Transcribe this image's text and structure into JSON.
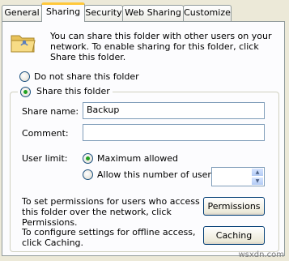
{
  "tabs": [
    {
      "label": "General"
    },
    {
      "label": "Sharing"
    },
    {
      "label": "Security"
    },
    {
      "label": "Web Sharing"
    },
    {
      "label": "Customize"
    }
  ],
  "active_tab": "Sharing",
  "intro_text": "You can share this folder with other users on your network.  To enable sharing for this folder, click Share this folder.",
  "options": {
    "do_not_share": "Do not share this folder",
    "share": "Share this folder"
  },
  "share_name": {
    "label": "Share name:",
    "value": "Backup"
  },
  "comment": {
    "label": "Comment:",
    "value": ""
  },
  "user_limit": {
    "label": "User limit:",
    "max_allowed": "Maximum allowed",
    "allow_number": "Allow this number of users:"
  },
  "permissions": {
    "text": "To set permissions for users who access this folder over the network, click Permissions.",
    "button": "Permissions"
  },
  "caching": {
    "text": "To configure settings for offline access, click Caching.",
    "button": "Caching"
  },
  "watermark": "wsxdn.com",
  "icons": {
    "folder": "shared-folder-icon",
    "spin_up": "spin-up-icon",
    "spin_down": "spin-down-icon"
  },
  "colors": {
    "accent": "#ffc83c",
    "radio_dot": "#21a121",
    "border": "#919b9c"
  }
}
